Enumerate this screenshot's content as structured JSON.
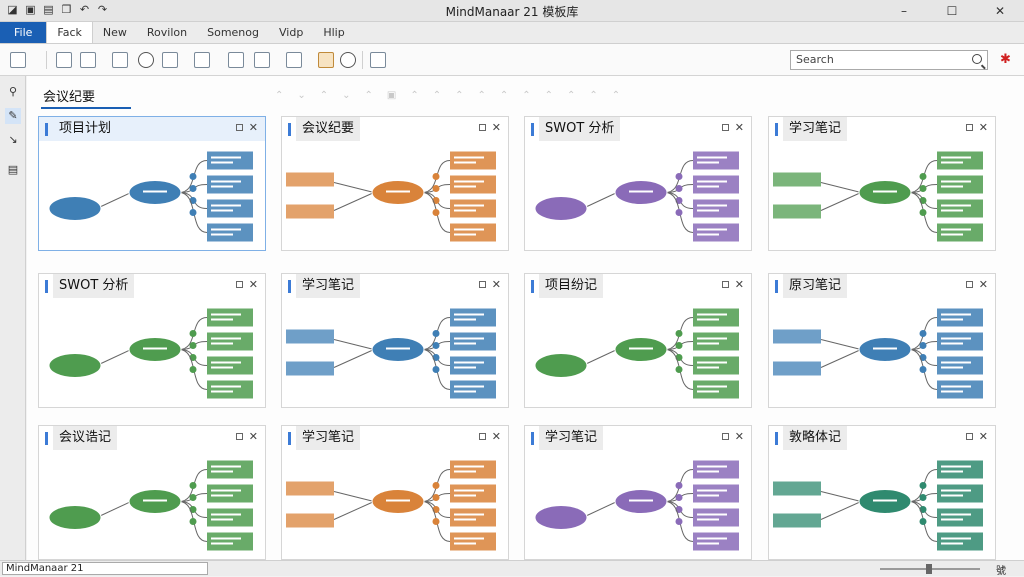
{
  "window": {
    "title": "MindManaar 21 模板库"
  },
  "menus": [
    "File",
    "Fack",
    "New",
    "Rovilon",
    "Somenog",
    "Vidp",
    "Hlip"
  ],
  "search": {
    "placeholder": "Search"
  },
  "tab": {
    "label": "会议纪要"
  },
  "colors": {
    "accent": "#1a5fb4",
    "blue": "#3f7fb5",
    "orange": "#d9833a",
    "purple": "#8a6bb8",
    "green": "#4f9c4f",
    "teal": "#2f8a6f"
  },
  "templates": [
    {
      "title": "项目计划",
      "theme": "blue"
    },
    {
      "title": "会议纪要",
      "theme": "orange"
    },
    {
      "title": "SWOT 分析",
      "theme": "purple"
    },
    {
      "title": "学习笔记",
      "theme": "green"
    },
    {
      "title": "SWOT 分析",
      "theme": "green"
    },
    {
      "title": "学习笔记",
      "theme": "blue"
    },
    {
      "title": "项目纷记",
      "theme": "green"
    },
    {
      "title": "原习笔记",
      "theme": "blue"
    },
    {
      "title": "会议诰记",
      "theme": "green"
    },
    {
      "title": "学习笔记",
      "theme": "orange"
    },
    {
      "title": "学习笔记",
      "theme": "purple"
    },
    {
      "title": "敦略体记",
      "theme": "teal"
    }
  ],
  "status": {
    "text": "MindManaar 21",
    "zoom_label": "號"
  }
}
